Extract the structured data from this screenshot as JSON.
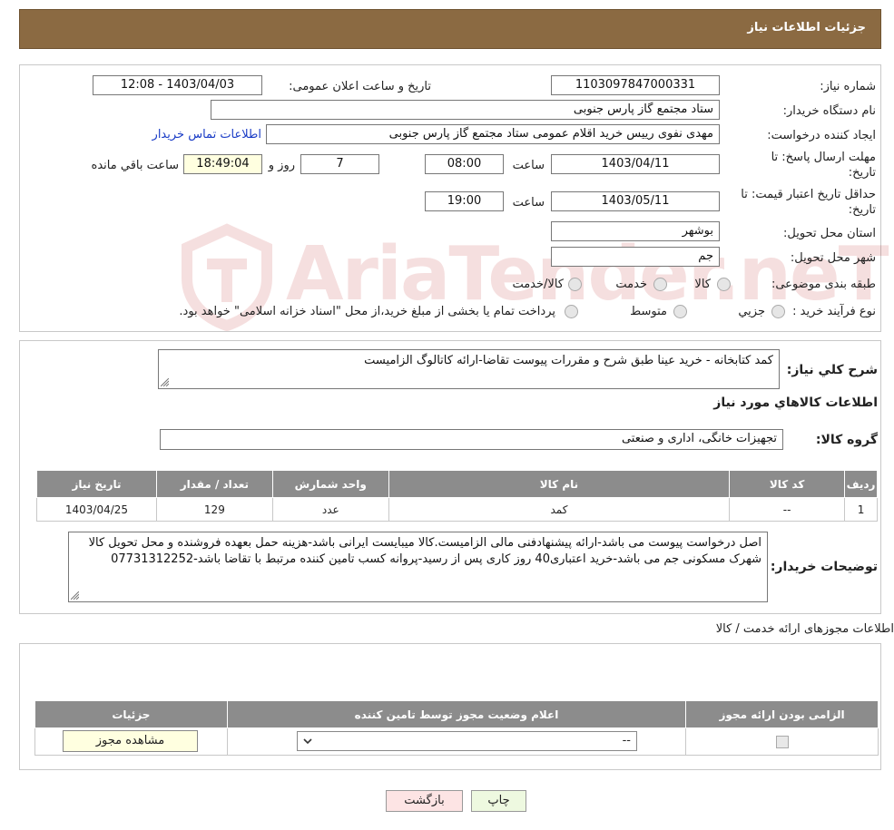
{
  "header": {
    "title": "جزئیات اطلاعات نیاز"
  },
  "details": {
    "need_number_label": "شماره نیاز:",
    "need_number": "1103097847000331",
    "announce_label": "تاریخ و ساعت اعلان عمومی:",
    "announce_value": "1403/04/03 - 12:08",
    "buyer_org_label": "نام دستگاه خریدار:",
    "buyer_org": "ستاد مجتمع گاز پارس جنوبی",
    "creator_label": "ایجاد کننده درخواست:",
    "creator": "مهدی نفوی رییس خرید اقلام عمومی ستاد مجتمع گاز پارس جنوبی",
    "contact_link": "اطلاعات تماس خریدار",
    "deadline_label_1": "مهلت ارسال پاسخ: تا",
    "deadline_label_2": "تاریخ:",
    "deadline_date": "1403/04/11",
    "time_label": "ساعت",
    "deadline_time": "08:00",
    "days_value": "7",
    "days_label": "روز و",
    "remaining_time": "18:49:04",
    "remaining_label": "ساعت باقي مانده",
    "validity_label_1": "حداقل تاریخ اعتبار قیمت: تا",
    "validity_label_2": "تاریخ:",
    "validity_date": "1403/05/11",
    "validity_time": "19:00",
    "province_label": "استان محل تحویل:",
    "province": "بوشهر",
    "city_label": "شهر محل تحویل:",
    "city": "جم",
    "category_label": "طبقه بندی موضوعی:",
    "category_options": [
      "کالا",
      "خدمت",
      "کالا/خدمت"
    ],
    "process_label": "نوع فرآیند خرید :",
    "process_options": [
      "جزیي",
      "متوسط"
    ],
    "process_note": "پرداخت تمام یا بخشی از مبلغ خرید،از محل \"اسناد خزانه اسلامی\" خواهد بود."
  },
  "watermark": {
    "text": "AriaTender.neT"
  },
  "summary": {
    "label": "شرح کلي نیاز:",
    "text": "کمد کتابخانه - خرید عینا طبق شرح و مقررات پیوست تقاضا-ارائه کاتالوگ الزامیست",
    "goods_info_title": "اطلاعات کالاهاي مورد نیاز",
    "group_label": "گروه کالا:",
    "group_value": "تجهیزات خانگی، اداری و صنعتی",
    "table_headers": [
      "ردیف",
      "کد کالا",
      "نام کالا",
      "واحد شمارش",
      "تعداد / مقدار",
      "تاریخ نیاز"
    ],
    "table_rows": [
      [
        "1",
        "--",
        "کمد",
        "عدد",
        "129",
        "1403/04/25"
      ]
    ],
    "buyer_notes_label": "توضیحات خریدار:",
    "buyer_notes": "اصل درخواست پیوست می باشد-ارائه پیشنهادفنی مالی الزامیست.کالا میبایست ایرانی باشد-هزینه حمل بعهده فروشنده و محل تحویل کالا شهرک مسکونی جم می باشد-خرید اعتباری40 روز کاری پس از رسید-پروانه کسب تامین کننده مرتبط با تقاضا باشد-07731312252"
  },
  "licenses": {
    "title": "اطلاعات مجوزهای ارائه خدمت / کالا",
    "headers": [
      "الزامی بودن ارائه مجوز",
      "اعلام وضعیت مجوز توسط تامین کننده",
      "جزئیات"
    ],
    "select_value": "--",
    "view_button": "مشاهده مجوز"
  },
  "footer": {
    "print_button": "چاپ",
    "back_button": "بازگشت"
  },
  "colors": {
    "header_bg": "#8B6A42",
    "table_header_bg": "#8c8c8c",
    "print_bg": "#eef9e0",
    "back_bg": "#fde4e4"
  }
}
